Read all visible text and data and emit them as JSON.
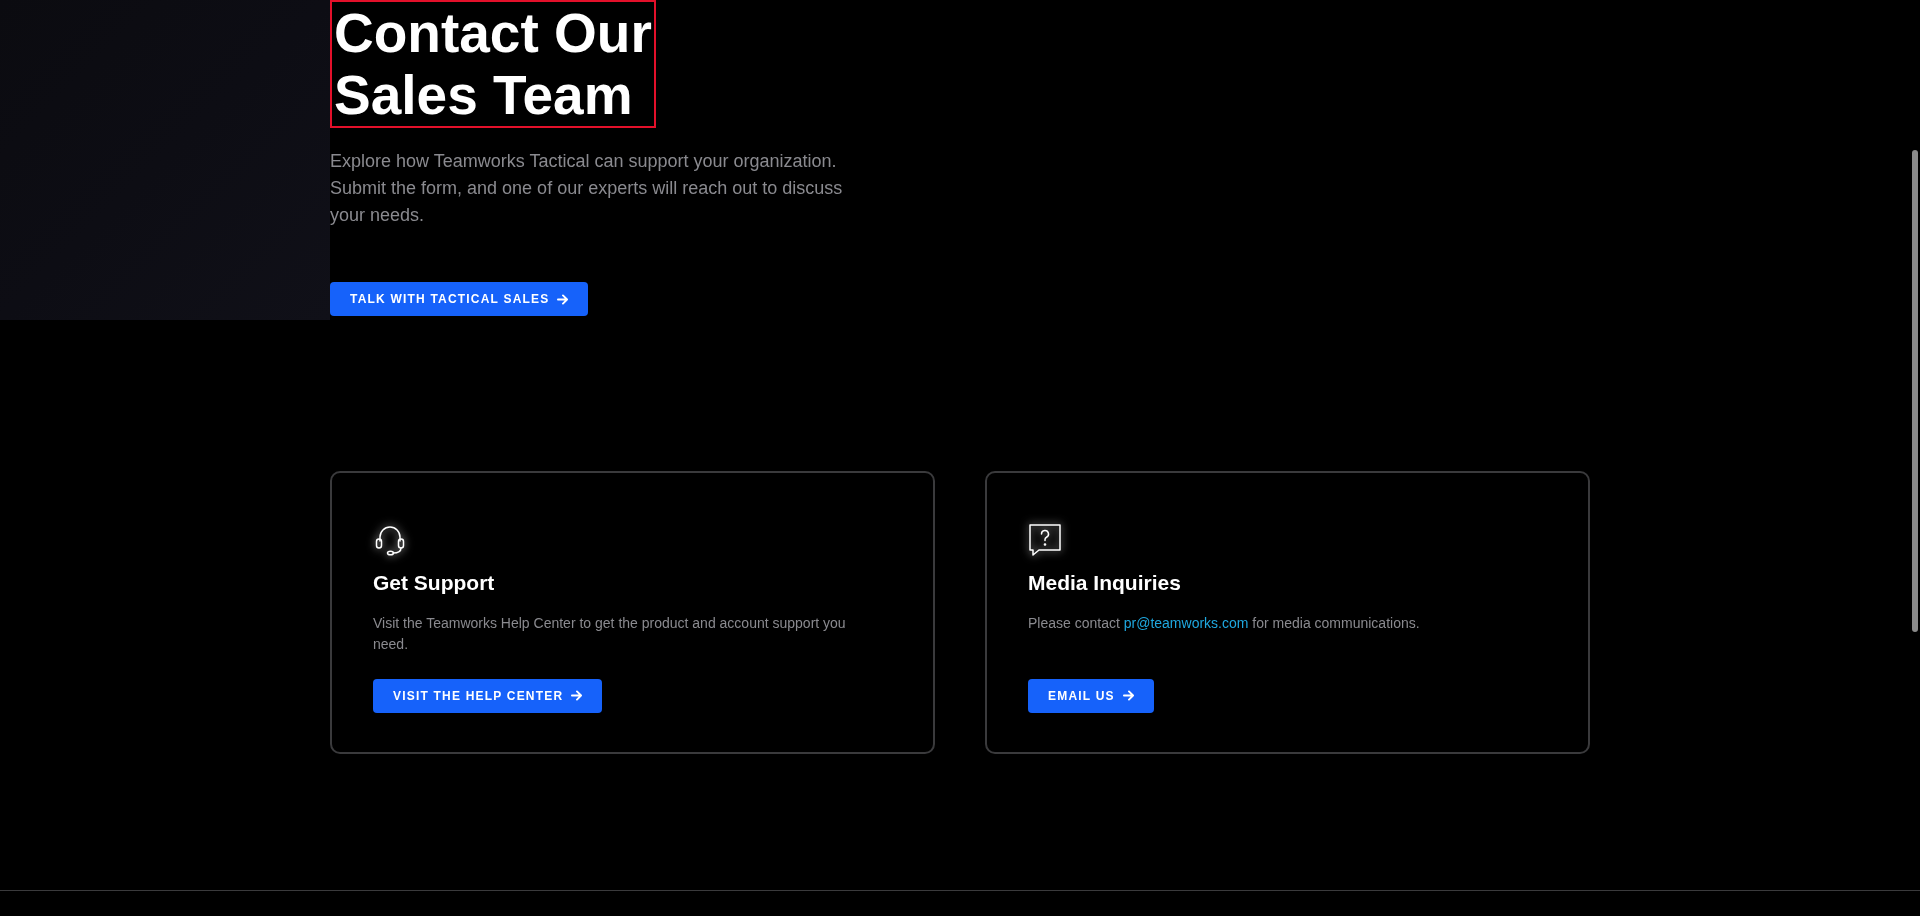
{
  "hero": {
    "title_lines": [
      "Contact Our",
      "Sales Team"
    ],
    "description": "Explore how Teamworks Tactical can support your organization. Submit the form, and one of our experts will reach out to discuss your needs.",
    "button": "TALK WITH TACTICAL SALES"
  },
  "cards": [
    {
      "kind": "support",
      "title": "Get Support",
      "text": "Visit the Teamworks Help Center to get the product and account support you need.",
      "button": "VISIT THE HELP CENTER"
    },
    {
      "kind": "media",
      "title": "Media Inquiries",
      "text_before": "Please contact ",
      "link": "pr@teamworks.com",
      "text_after": " for media communications.",
      "button": "EMAIL US"
    }
  ]
}
